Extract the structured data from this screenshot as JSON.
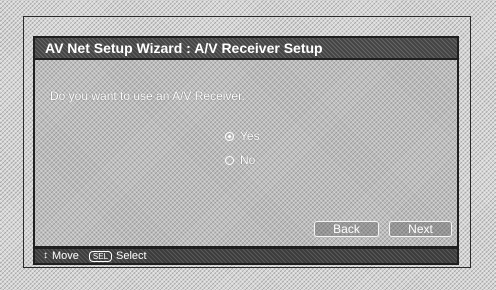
{
  "wizard": {
    "title": "AV Net Setup Wizard : A/V Receiver Setup",
    "question": "Do you want to use an A/V Receiver.",
    "options": [
      {
        "label": "Yes",
        "selected": true
      },
      {
        "label": "No",
        "selected": false
      }
    ],
    "buttons": {
      "back": "Back",
      "next": "Next"
    }
  },
  "footer": {
    "move_icon": "↕",
    "move_label": "Move",
    "sel_key": "SEL",
    "select_label": "Select"
  }
}
